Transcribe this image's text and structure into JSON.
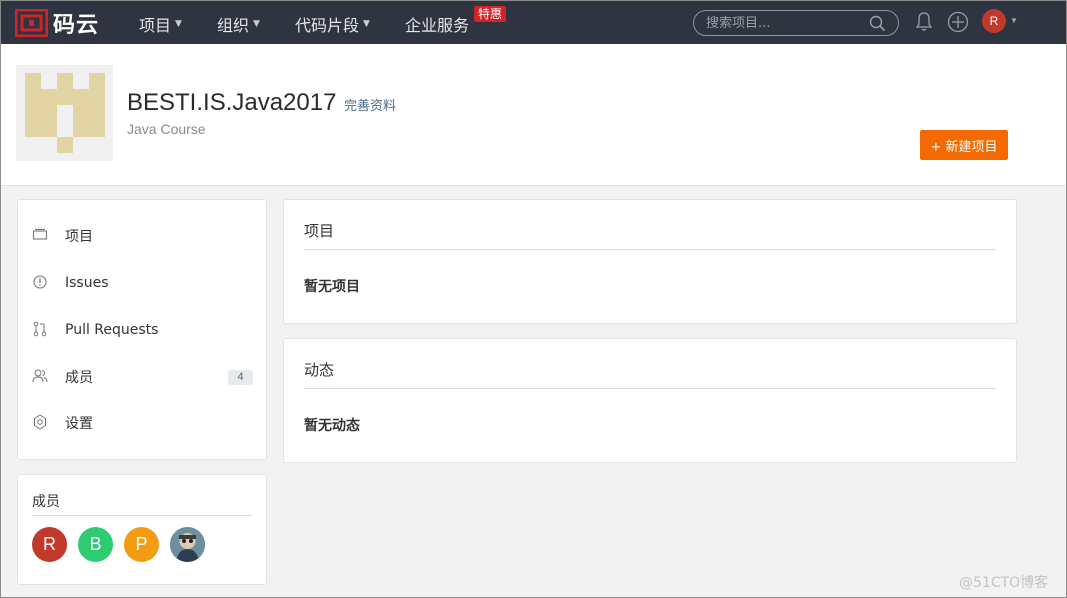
{
  "navbar": {
    "logo_text": "码云",
    "items": [
      {
        "label": "项目"
      },
      {
        "label": "组织"
      },
      {
        "label": "代码片段"
      },
      {
        "label": "企业服务"
      }
    ],
    "promo_badge": "特惠",
    "search_placeholder": "搜索项目...",
    "user_initial": "R"
  },
  "profile": {
    "name": "BESTI.IS.Java2017",
    "edit_link": "完善资料",
    "description": "Java Course",
    "new_project_button": "+ 新建项目"
  },
  "sidebar": {
    "items": [
      {
        "label": "项目",
        "icon": "folder-icon"
      },
      {
        "label": "Issues",
        "icon": "issue-icon"
      },
      {
        "label": "Pull Requests",
        "icon": "pull-request-icon"
      },
      {
        "label": "成员",
        "icon": "members-icon",
        "count": "4"
      },
      {
        "label": "设置",
        "icon": "gear-icon"
      }
    ]
  },
  "members": {
    "title": "成员",
    "list": [
      {
        "initial": "R",
        "color": "#c0392b"
      },
      {
        "initial": "B",
        "color": "#2ecc71"
      },
      {
        "initial": "P",
        "color": "#f39c12"
      },
      {
        "initial": "",
        "color": "#5b7c8d"
      }
    ]
  },
  "projects_card": {
    "title": "项目",
    "empty_text": "暂无项目"
  },
  "activity_card": {
    "title": "动态",
    "empty_text": "暂无动态"
  },
  "watermark": "@51CTO博客",
  "colors": {
    "navbar_bg": "#2e3440",
    "accent_orange": "#f56a00",
    "promo_red": "#d2232a"
  }
}
